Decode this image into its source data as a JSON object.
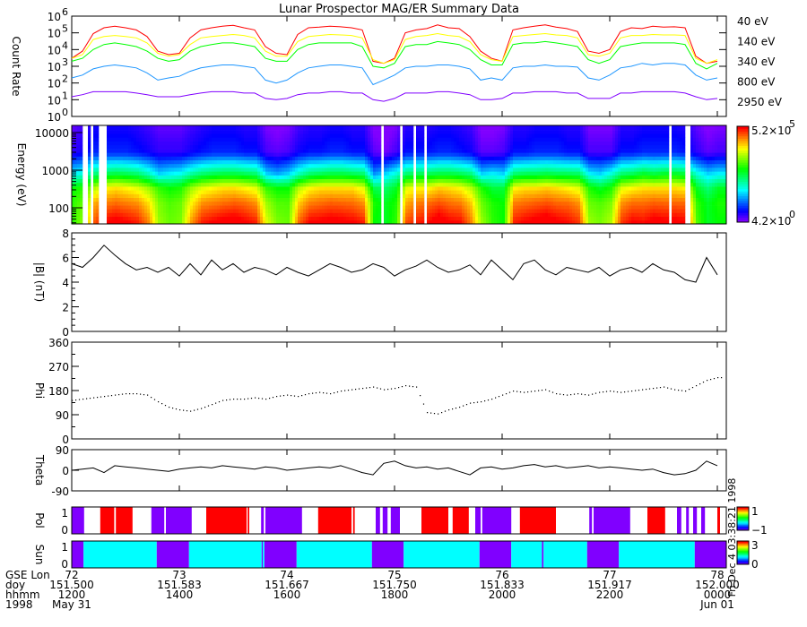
{
  "chart_data": {
    "title": "Lunar Prospector MAG/ER Summary Data",
    "timestamp": "Fri Dec 4 03:38:21 1998",
    "times_ut_hours": [
      12.0,
      12.2,
      12.4,
      12.6,
      12.8,
      13.0,
      13.2,
      13.4,
      13.6,
      13.8,
      14.0,
      14.2,
      14.4,
      14.6,
      14.8,
      15.0,
      15.2,
      15.4,
      15.6,
      15.8,
      16.0,
      16.2,
      16.4,
      16.6,
      16.8,
      17.0,
      17.2,
      17.4,
      17.6,
      17.8,
      18.0,
      18.2,
      18.4,
      18.6,
      18.8,
      19.0,
      19.2,
      19.4,
      19.6,
      19.8,
      20.0,
      20.2,
      20.4,
      20.6,
      20.8,
      21.0,
      21.2,
      21.4,
      21.6,
      21.8,
      22.0,
      22.2,
      22.4,
      22.6,
      22.8,
      23.0,
      23.2,
      23.4,
      23.6,
      23.8,
      24.0
    ],
    "x_axis": {
      "tick_hours": [
        12,
        14,
        16,
        18,
        20,
        22,
        24
      ],
      "rows": [
        {
          "label": "GSE Lon",
          "values": [
            "72",
            "73",
            "74",
            "75",
            "76",
            "77",
            "78"
          ]
        },
        {
          "label": "doy",
          "values": [
            "151.500",
            "151.583",
            "151.667",
            "151.750",
            "151.833",
            "151.917",
            "152.000"
          ]
        },
        {
          "label": "hhmm",
          "values": [
            "1200",
            "1400",
            "1600",
            "1800",
            "2000",
            "2200",
            "0000"
          ]
        },
        {
          "label": "1998",
          "values": [
            "May 31",
            "",
            "",
            "",
            "",
            "",
            "Jun 01"
          ]
        }
      ]
    },
    "counts": {
      "type": "line",
      "ylabel": "Count Rate",
      "yscale": "log",
      "ylim": [
        1,
        1000000
      ],
      "ytick_exponents": [
        0,
        1,
        2,
        3,
        4,
        5,
        6
      ],
      "series": [
        {
          "name": "40 eV",
          "energy": 40,
          "color": "#ff0000",
          "values": [
            3000,
            8000,
            90000,
            200000,
            250000,
            200000,
            150000,
            60000,
            8000,
            5000,
            6000,
            50000,
            150000,
            200000,
            250000,
            280000,
            200000,
            150000,
            15000,
            6000,
            5000,
            80000,
            200000,
            220000,
            250000,
            230000,
            200000,
            150000,
            2000,
            1500,
            3000,
            100000,
            150000,
            180000,
            300000,
            200000,
            180000,
            60000,
            8000,
            3000,
            2000,
            150000,
            200000,
            250000,
            300000,
            220000,
            180000,
            120000,
            8000,
            6000,
            10000,
            120000,
            200000,
            180000,
            250000,
            220000,
            230000,
            200000,
            4000,
            1500,
            2000
          ]
        },
        {
          "name": "140 eV",
          "energy": 140,
          "color": "#ffff00",
          "values": [
            3000,
            5000,
            40000,
            60000,
            70000,
            60000,
            50000,
            25000,
            6000,
            4000,
            5000,
            20000,
            50000,
            60000,
            70000,
            80000,
            70000,
            50000,
            8000,
            4000,
            4000,
            30000,
            60000,
            70000,
            80000,
            75000,
            70000,
            50000,
            2500,
            1500,
            2500,
            40000,
            60000,
            70000,
            90000,
            70000,
            60000,
            30000,
            5000,
            2500,
            2000,
            60000,
            70000,
            80000,
            90000,
            75000,
            70000,
            50000,
            5000,
            4000,
            6000,
            50000,
            70000,
            70000,
            80000,
            75000,
            75000,
            70000,
            3000,
            1500,
            2500
          ]
        },
        {
          "name": "340 eV",
          "energy": 340,
          "color": "#00ff00",
          "values": [
            2000,
            3000,
            10000,
            20000,
            25000,
            20000,
            15000,
            8000,
            3000,
            2000,
            2500,
            8000,
            15000,
            20000,
            25000,
            25000,
            20000,
            15000,
            3000,
            2000,
            2000,
            10000,
            20000,
            25000,
            25000,
            25000,
            25000,
            15000,
            1000,
            800,
            1500,
            15000,
            20000,
            20000,
            30000,
            25000,
            20000,
            10000,
            2500,
            1200,
            1200,
            20000,
            25000,
            25000,
            30000,
            25000,
            20000,
            15000,
            2500,
            1500,
            2500,
            15000,
            20000,
            25000,
            25000,
            25000,
            25000,
            20000,
            1500,
            700,
            1500
          ]
        },
        {
          "name": "800 eV",
          "energy": 800,
          "color": "#1e96ff",
          "values": [
            200,
            300,
            700,
            1000,
            1200,
            1000,
            800,
            400,
            150,
            200,
            250,
            500,
            800,
            1000,
            1200,
            1200,
            1000,
            800,
            150,
            100,
            150,
            400,
            800,
            1000,
            1200,
            1200,
            1000,
            800,
            80,
            150,
            300,
            800,
            1000,
            1000,
            1200,
            1200,
            1000,
            700,
            150,
            200,
            150,
            800,
            1000,
            1000,
            1200,
            1000,
            1000,
            900,
            200,
            150,
            300,
            800,
            1000,
            1500,
            1200,
            1500,
            1500,
            1200,
            300,
            150,
            200
          ]
        },
        {
          "name": "2950 eV",
          "energy": 2950,
          "color": "#8000ff",
          "values": [
            15,
            20,
            30,
            30,
            30,
            30,
            25,
            20,
            15,
            15,
            15,
            20,
            25,
            30,
            30,
            30,
            25,
            25,
            12,
            10,
            12,
            20,
            25,
            25,
            30,
            30,
            25,
            25,
            10,
            8,
            12,
            25,
            25,
            25,
            30,
            30,
            25,
            20,
            10,
            10,
            12,
            25,
            25,
            30,
            30,
            30,
            25,
            25,
            12,
            12,
            12,
            25,
            25,
            30,
            30,
            30,
            30,
            25,
            15,
            10,
            12
          ]
        }
      ]
    },
    "spectrogram": {
      "type": "heatmap",
      "ylabel": "Energy (eV)",
      "yscale": "log",
      "ylim": [
        37,
        15600
      ],
      "yticks": [
        100,
        1000,
        10000
      ],
      "zlim": [
        4.2,
        520000
      ],
      "colorbar_top": {
        "mantissa": "5.2×10",
        "exp": "5"
      },
      "colorbar_bottom": {
        "mantissa": "4.2×10",
        "exp": "0"
      },
      "gaps_ut_hours": [
        [
          12.22,
          12.28
        ],
        [
          12.37,
          12.42
        ],
        [
          12.5,
          12.63
        ],
        [
          17.75,
          17.8
        ],
        [
          18.08,
          18.13
        ],
        [
          18.37,
          18.42
        ],
        [
          18.53,
          18.62
        ],
        [
          23.08,
          23.13
        ],
        [
          23.42,
          23.5
        ]
      ]
    },
    "bmag": {
      "type": "line",
      "ylabel": "|B| (nT)",
      "ylim": [
        0,
        8
      ],
      "yticks": [
        0,
        2,
        4,
        6,
        8
      ],
      "values": [
        5.5,
        5.2,
        6.0,
        7.0,
        6.2,
        5.5,
        5.0,
        5.2,
        4.8,
        5.2,
        4.5,
        5.5,
        4.6,
        5.8,
        5.0,
        5.5,
        4.8,
        5.2,
        5.0,
        4.6,
        5.2,
        4.8,
        4.5,
        5.0,
        5.5,
        5.2,
        4.8,
        5.0,
        5.5,
        5.2,
        4.5,
        5.0,
        5.3,
        5.8,
        5.2,
        4.8,
        5.0,
        5.4,
        4.6,
        5.8,
        5.0,
        4.2,
        5.5,
        5.8,
        5.0,
        4.6,
        5.2,
        5.0,
        4.8,
        5.2,
        4.5,
        5.0,
        5.2,
        4.8,
        5.5,
        5.0,
        4.8,
        4.2,
        4.0,
        6.0,
        4.6
      ]
    },
    "phi": {
      "type": "scatter",
      "ylabel": "Phi",
      "ylim": [
        0,
        360
      ],
      "yticks": [
        0,
        90,
        180,
        270,
        360
      ],
      "values": [
        145,
        150,
        155,
        160,
        165,
        170,
        170,
        165,
        140,
        120,
        110,
        105,
        115,
        130,
        145,
        150,
        150,
        155,
        150,
        160,
        165,
        160,
        170,
        175,
        170,
        180,
        185,
        190,
        195,
        185,
        190,
        200,
        195,
        100,
        95,
        110,
        120,
        135,
        140,
        150,
        165,
        180,
        175,
        180,
        185,
        170,
        165,
        170,
        165,
        175,
        180,
        175,
        180,
        185,
        190,
        195,
        185,
        180,
        200,
        220,
        230
      ]
    },
    "theta": {
      "type": "line",
      "ylabel": "Theta",
      "ylim": [
        -90,
        90
      ],
      "yticks": [
        -90,
        0,
        90
      ],
      "values": [
        0,
        5,
        10,
        -10,
        20,
        15,
        10,
        5,
        0,
        -5,
        5,
        10,
        15,
        10,
        20,
        15,
        10,
        5,
        15,
        10,
        0,
        5,
        10,
        15,
        10,
        20,
        5,
        -10,
        -20,
        30,
        40,
        20,
        10,
        15,
        5,
        10,
        -5,
        -20,
        10,
        15,
        5,
        10,
        20,
        25,
        15,
        20,
        10,
        15,
        20,
        10,
        15,
        10,
        5,
        0,
        5,
        -10,
        -20,
        -15,
        0,
        40,
        20
      ]
    },
    "pol": {
      "type": "segments",
      "ylabel": "Pol",
      "yticks": [
        0,
        1
      ],
      "colorbar_labels": [
        "1",
        "−1"
      ],
      "colors": {
        "-1": "#8000ff",
        "1": "#ff0000"
      },
      "segments": [
        {
          "start": 12.0,
          "end": 12.23,
          "value": -1
        },
        {
          "start": 12.53,
          "end": 12.79,
          "value": 1
        },
        {
          "start": 12.82,
          "end": 13.13,
          "value": 1
        },
        {
          "start": 13.48,
          "end": 13.72,
          "value": -1
        },
        {
          "start": 13.75,
          "end": 14.23,
          "value": -1
        },
        {
          "start": 14.5,
          "end": 15.25,
          "value": 1
        },
        {
          "start": 15.27,
          "end": 15.3,
          "value": 1
        },
        {
          "start": 15.52,
          "end": 15.57,
          "value": -1
        },
        {
          "start": 15.6,
          "end": 16.28,
          "value": -1
        },
        {
          "start": 16.58,
          "end": 17.2,
          "value": 1
        },
        {
          "start": 17.23,
          "end": 17.26,
          "value": 1
        },
        {
          "start": 17.65,
          "end": 17.73,
          "value": -1
        },
        {
          "start": 17.78,
          "end": 17.87,
          "value": -1
        },
        {
          "start": 17.93,
          "end": 18.1,
          "value": -1
        },
        {
          "start": 18.5,
          "end": 19.0,
          "value": 1
        },
        {
          "start": 19.08,
          "end": 19.38,
          "value": 1
        },
        {
          "start": 19.5,
          "end": 19.6,
          "value": -1
        },
        {
          "start": 19.63,
          "end": 20.17,
          "value": -1
        },
        {
          "start": 20.33,
          "end": 21.0,
          "value": 1
        },
        {
          "start": 21.62,
          "end": 21.67,
          "value": -1
        },
        {
          "start": 21.7,
          "end": 22.38,
          "value": -1
        },
        {
          "start": 22.7,
          "end": 23.03,
          "value": 1
        },
        {
          "start": 23.25,
          "end": 23.33,
          "value": -1
        },
        {
          "start": 23.42,
          "end": 23.47,
          "value": -1
        },
        {
          "start": 23.55,
          "end": 23.62,
          "value": -1
        },
        {
          "start": 23.7,
          "end": 23.77,
          "value": -1
        },
        {
          "start": 24.0,
          "end": 24.05,
          "value": 1
        }
      ]
    },
    "sun": {
      "type": "segments",
      "ylabel": "Sun",
      "yticks": [
        0,
        1
      ],
      "colorbar_labels": [
        "3",
        "0"
      ],
      "colors": {
        "0": "#8000ff",
        "1": "#00ffff"
      },
      "segments": [
        {
          "start": 12.0,
          "end": 12.22,
          "value": 0
        },
        {
          "start": 12.22,
          "end": 13.58,
          "value": 1
        },
        {
          "start": 13.58,
          "end": 14.18,
          "value": 0
        },
        {
          "start": 14.18,
          "end": 15.53,
          "value": 1
        },
        {
          "start": 15.53,
          "end": 15.55,
          "value": 0
        },
        {
          "start": 15.55,
          "end": 15.58,
          "value": 1
        },
        {
          "start": 15.58,
          "end": 16.18,
          "value": 0
        },
        {
          "start": 16.18,
          "end": 17.58,
          "value": 1
        },
        {
          "start": 17.58,
          "end": 18.17,
          "value": 0
        },
        {
          "start": 18.17,
          "end": 19.58,
          "value": 1
        },
        {
          "start": 19.58,
          "end": 20.17,
          "value": 0
        },
        {
          "start": 20.17,
          "end": 20.74,
          "value": 1
        },
        {
          "start": 20.74,
          "end": 20.77,
          "value": 0
        },
        {
          "start": 20.77,
          "end": 21.58,
          "value": 1
        },
        {
          "start": 21.58,
          "end": 22.17,
          "value": 0
        },
        {
          "start": 22.17,
          "end": 23.58,
          "value": 1
        },
        {
          "start": 23.58,
          "end": 24.17,
          "value": 0
        }
      ]
    }
  }
}
